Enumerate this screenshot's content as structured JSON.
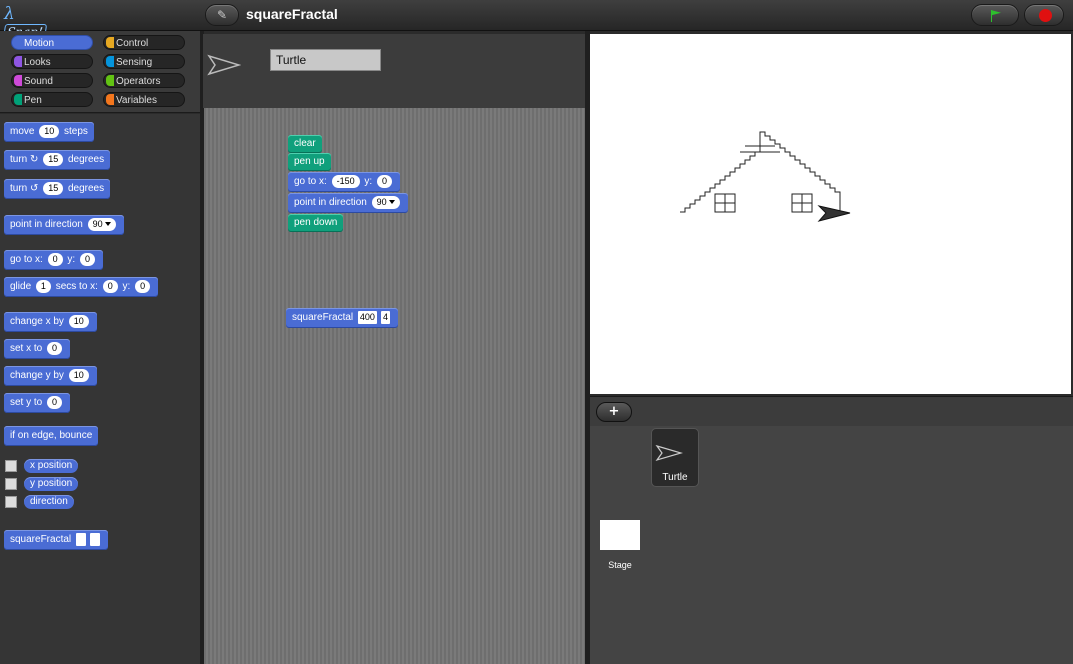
{
  "app": {
    "logo_lambda": "λ",
    "logo_text": "Snap!",
    "project_title": "squareFractal",
    "edit_glyph": "✎"
  },
  "categories": [
    {
      "label": "Motion",
      "color": "#4a6cd4",
      "active": true
    },
    {
      "label": "Control",
      "color": "#e6a822"
    },
    {
      "label": "Looks",
      "color": "#8f56e3"
    },
    {
      "label": "Sensing",
      "color": "#0494dc"
    },
    {
      "label": "Sound",
      "color": "#cf4ad9"
    },
    {
      "label": "Operators",
      "color": "#62c213"
    },
    {
      "label": "Pen",
      "color": "#00a178"
    },
    {
      "label": "Variables",
      "color": "#f3761d"
    }
  ],
  "palette": {
    "move": {
      "pre": "move",
      "val": "10",
      "post": "steps"
    },
    "turn_cw": {
      "pre": "turn",
      "icon": "↻",
      "val": "15",
      "post": "degrees"
    },
    "turn_ccw": {
      "pre": "turn",
      "icon": "↺",
      "val": "15",
      "post": "degrees"
    },
    "point_dir": {
      "pre": "point in direction",
      "val": "90"
    },
    "goto": {
      "pre": "go to x:",
      "x": "0",
      "mid": "y:",
      "y": "0"
    },
    "glide": {
      "pre": "glide",
      "secs": "1",
      "mid1": "secs to x:",
      "x": "0",
      "mid2": "y:",
      "y": "0"
    },
    "change_x": {
      "pre": "change x by",
      "val": "10"
    },
    "set_x": {
      "pre": "set x to",
      "val": "0"
    },
    "change_y": {
      "pre": "change y by",
      "val": "10"
    },
    "set_y": {
      "pre": "set y to",
      "val": "0"
    },
    "bounce": {
      "label": "if on edge, bounce"
    },
    "reporters": [
      "x position",
      "y position",
      "direction"
    ],
    "custom": {
      "label": "squareFractal"
    }
  },
  "sprite": {
    "name": "Turtle"
  },
  "scripts": {
    "clear": "clear",
    "pen_up": "pen up",
    "goto": {
      "pre": "go to x:",
      "x": "-150",
      "mid": "y:",
      "y": "0"
    },
    "point": {
      "pre": "point in direction",
      "val": "90"
    },
    "pen_down": "pen down",
    "fractal": {
      "label": "squareFractal",
      "a": "400",
      "b": "4"
    }
  },
  "corral": {
    "add_glyph": "+",
    "sprites": [
      "Turtle"
    ],
    "stage_label": "Stage"
  }
}
